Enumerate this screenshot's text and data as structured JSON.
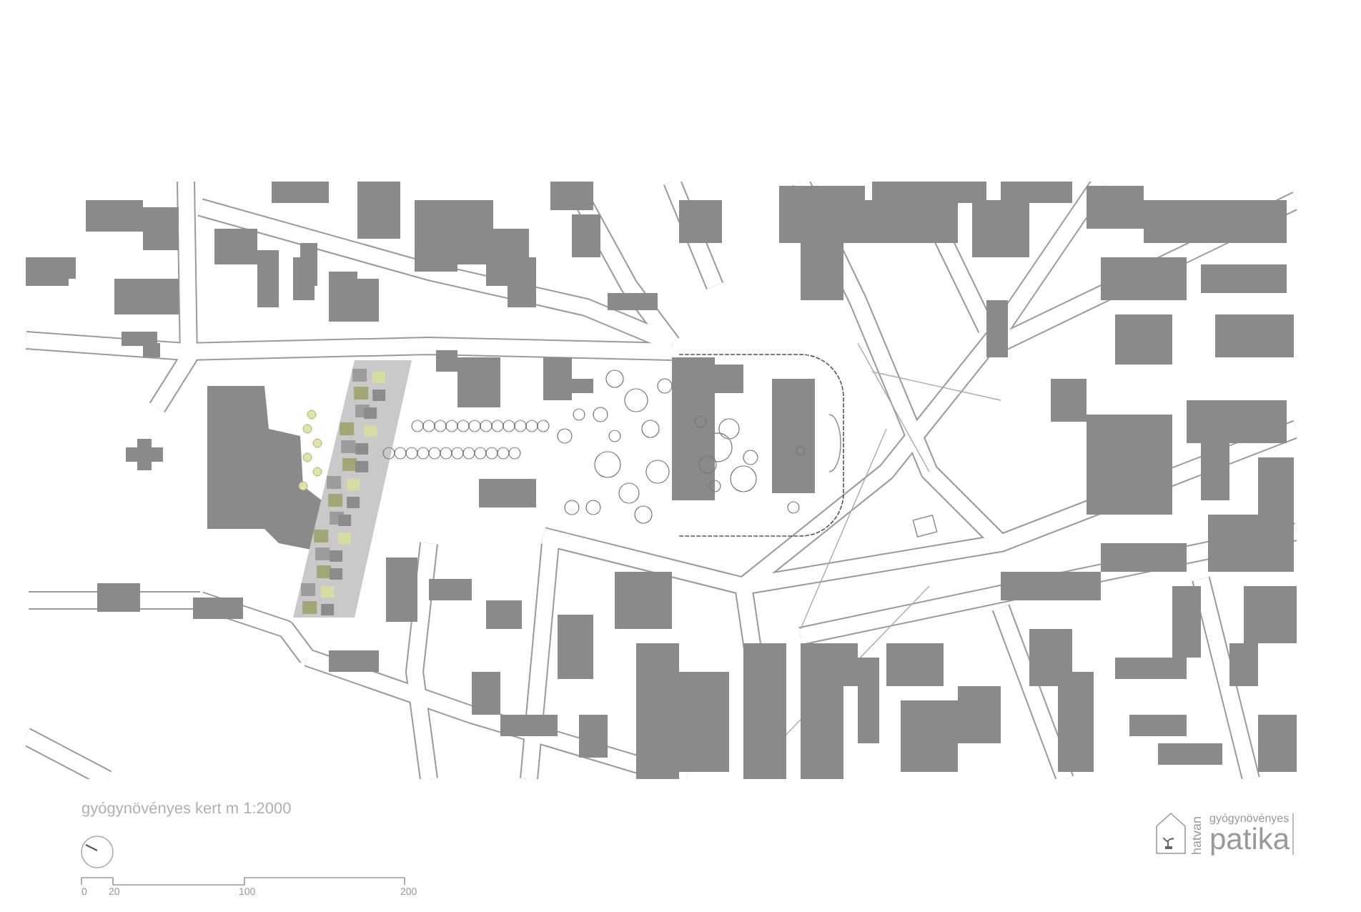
{
  "caption": "gyógynövényes kert m 1:2000",
  "scale_labels": [
    "0",
    "20",
    "100",
    "200"
  ],
  "logo": {
    "side": "hatvan",
    "top": "gyógynövényes",
    "main": "patika"
  }
}
